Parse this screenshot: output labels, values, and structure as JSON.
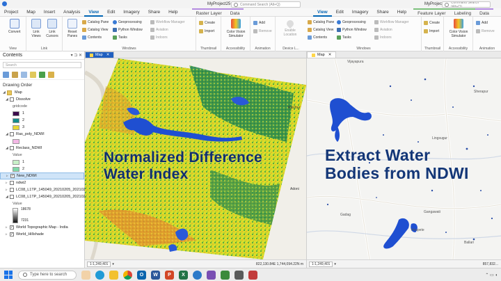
{
  "left_window": {
    "title": "MyProject25",
    "search_placeholder": "Command Search (Alt+Q)",
    "tabs": [
      "Project",
      "Map",
      "Insert",
      "Analysis",
      "View",
      "Edit",
      "Imagery",
      "Share",
      "Help"
    ],
    "active_tab": "View",
    "context_tabs": [
      "Raster Layer",
      "Data"
    ]
  },
  "right_window": {
    "title": "MyProject25",
    "search_placeholder": "Command Search (Alt+Q)",
    "tabs": [
      "View",
      "Edit",
      "Imagery",
      "Share",
      "Help"
    ],
    "active_tab": "View",
    "context_tabs": [
      "Feature Layer",
      "Labeling",
      "Data"
    ]
  },
  "ribbon": {
    "convert": "Convert",
    "link_views": "Link Views",
    "link_cursors": "Link Cursors",
    "reset_panes": "Reset Panes",
    "catalog_pane": "Catalog Pane",
    "catalog_view": "Catalog View",
    "contents": "Contents",
    "geoprocessing": "Geoprocessing",
    "python_window": "Python Window",
    "tasks": "Tasks",
    "workflow_manager": "Workflow Manager",
    "aviation": "Aviation",
    "indoors": "Indoors",
    "create": "Create",
    "import": "Import",
    "color_vision": "Color Vision Simulator",
    "add": "Add",
    "remove": "Remove",
    "enable_location": "Enable Location",
    "groups": {
      "view": "View",
      "link": "Link",
      "windows": "Windows",
      "thumbnail": "Thumbnail",
      "accessibility": "Accessibility",
      "animation": "Animation",
      "device_location": "Device L..."
    }
  },
  "contents": {
    "title": "Contents",
    "search_placeholder": "Search",
    "drawing_order": "Drawing Order",
    "layers": {
      "map": "Map",
      "dissolve": "Dissolve",
      "gridcode": "gridcode",
      "ras_poly": "Ras_poly_NDWI",
      "reclass": "Reclass_NDWI",
      "value": "Value",
      "new_ndwi": "New_NDWI",
      "ndwi2": "ndwi2",
      "lc08_a": "LC08_L1TP_145049_20210205_2021020...",
      "lc08_b": "LC08_L1TP_145049_20210205_2021020...",
      "value2": "Value",
      "topo": "World Topographic Map - India",
      "hillshade": "World_Hillshade"
    },
    "legend_values": [
      "1",
      "2",
      "3"
    ],
    "reclass_values": [
      "1",
      "2"
    ],
    "ramp_high": "18678",
    "ramp_low": "7231"
  },
  "left_map": {
    "tab": "Map",
    "overlay_line1": "Normalized Difference",
    "overlay_line2": "Water Index",
    "scale": "1:1,249,401",
    "coords": "822,130.84E 1,744,094.22N m"
  },
  "right_map": {
    "tab": "Map",
    "overlay_line1": "Extract Water",
    "overlay_line2": "Bodies from NDWI",
    "scale": "1:1,249,401",
    "coords": "857,832...",
    "places": [
      "Vijayapura",
      "Sherapur",
      "Raichur",
      "Lingsugur",
      "Gadag",
      "Gangawati",
      "Hospete",
      "Ballari"
    ]
  },
  "taskbar": {
    "search_placeholder": "Type here to search"
  },
  "colors": {
    "accent": "#0064b4",
    "water": "#1f4fd1",
    "overlay_text": "#133677"
  }
}
